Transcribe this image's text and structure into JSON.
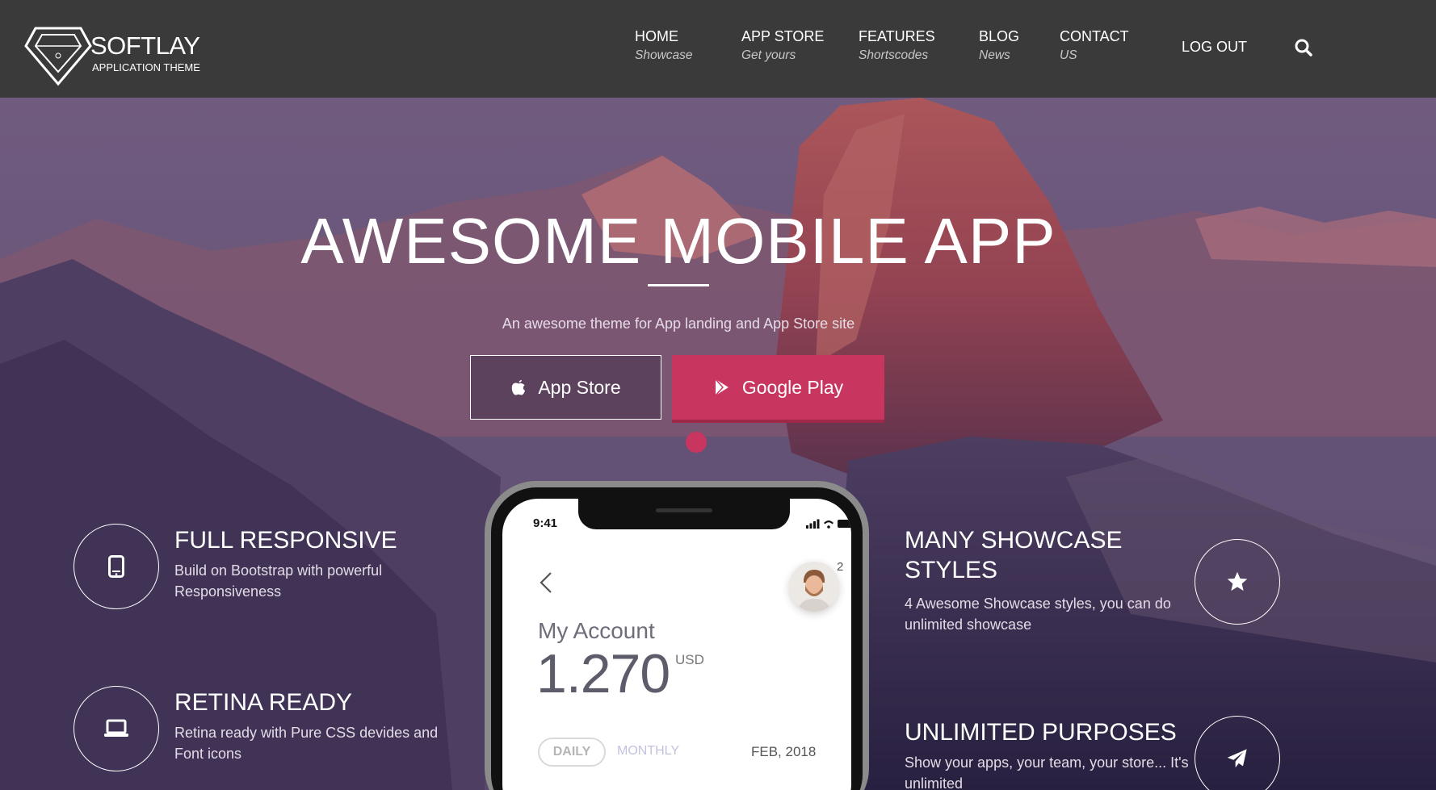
{
  "brand": {
    "name": "SOFTLAY",
    "tagline": "APPLICATION THEME"
  },
  "nav": {
    "items": [
      {
        "label": "HOME",
        "sublabel": "Showcase"
      },
      {
        "label": "APP STORE",
        "sublabel": "Get yours"
      },
      {
        "label": "FEATURES",
        "sublabel": "Shortscodes"
      },
      {
        "label": "BLOG",
        "sublabel": "News"
      },
      {
        "label": "CONTACT",
        "sublabel": "US"
      }
    ],
    "logout": "LOG OUT",
    "search_icon": "search-icon"
  },
  "hero": {
    "title": "AWESOME MOBILE APP",
    "subtitle": "An awesome theme for App landing and App Store site",
    "app_store_label": "App Store",
    "google_play_label": "Google Play"
  },
  "features": {
    "left": [
      {
        "title": "FULL RESPONSIVE",
        "desc": "Build on Bootstrap with powerful Responsiveness",
        "icon": "mobile-icon"
      },
      {
        "title": "RETINA READY",
        "desc": "Retina ready with Pure CSS devides and Font icons",
        "icon": "laptop-icon"
      }
    ],
    "right": [
      {
        "title": "MANY SHOWCASE STYLES",
        "desc": "4 Awesome Showcase styles, you can do unlimited showcase",
        "icon": "star-icon"
      },
      {
        "title": "UNLIMITED PURPOSES",
        "desc": "Show your apps, your team, your store... It's unlimited",
        "icon": "paper-plane-icon"
      }
    ]
  },
  "phone": {
    "time": "9:41",
    "badge": "2",
    "account_label": "My Account",
    "amount": "1.270",
    "currency": "USD",
    "tab_daily": "DAILY",
    "tab_monthly": "MONTHLY",
    "date": "FEB, 2018"
  },
  "colors": {
    "header_bg": "#3a3a3a",
    "accent": "#c8365f"
  }
}
